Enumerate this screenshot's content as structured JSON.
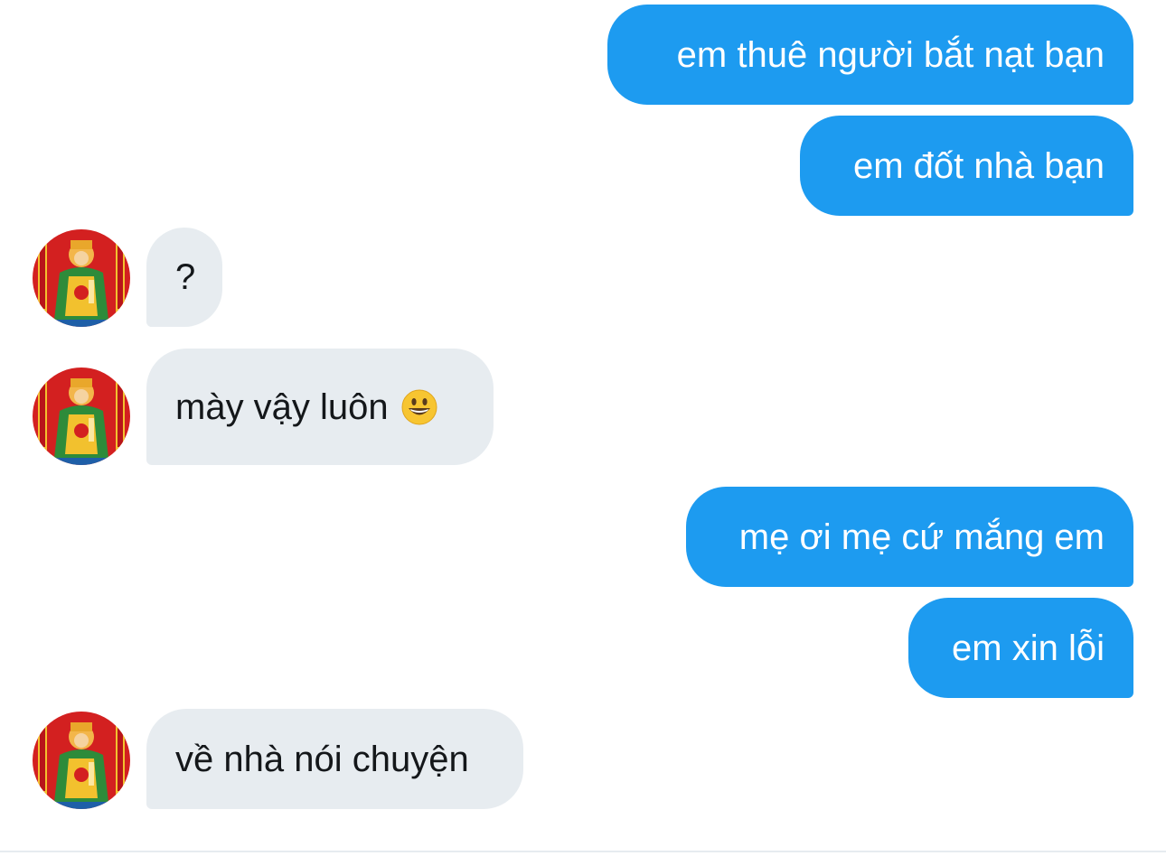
{
  "messages": [
    {
      "side": "out",
      "text": "em thuê người bắt nạt bạn"
    },
    {
      "side": "out",
      "text": "em đốt nhà bạn"
    },
    {
      "side": "in",
      "text": "?"
    },
    {
      "side": "in",
      "text": "mày vậy luôn",
      "emoji": "smiling-face-emoji"
    },
    {
      "side": "out",
      "text": "mẹ ơi mẹ cứ mắng em"
    },
    {
      "side": "out",
      "text": "em xin lỗi"
    },
    {
      "side": "in",
      "text": "về nhà nói chuyện"
    }
  ],
  "colors": {
    "outgoing_bubble": "#1d9bf0",
    "incoming_bubble": "#e7ecf0",
    "outgoing_text": "#ffffff",
    "incoming_text": "#14171a"
  },
  "avatar": {
    "icon": "deity-portrait-avatar"
  }
}
